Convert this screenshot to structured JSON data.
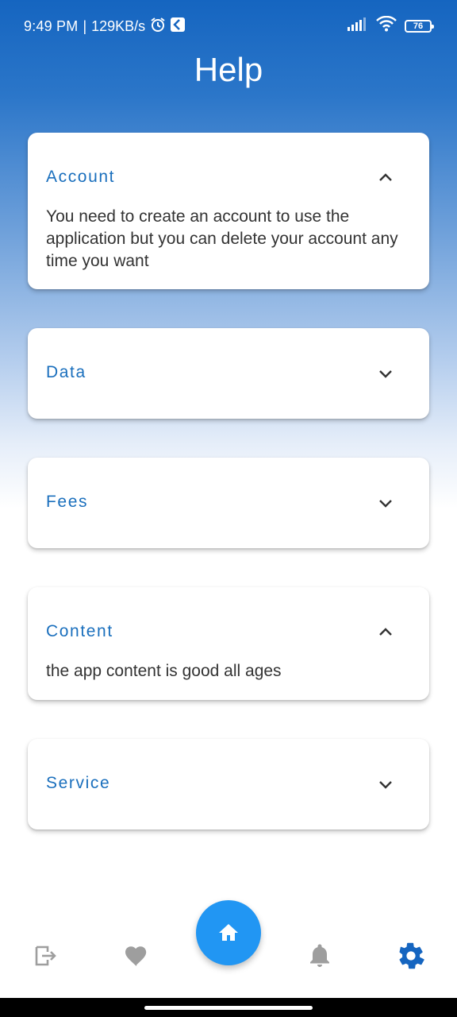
{
  "status": {
    "time": "9:49 PM",
    "separator": "|",
    "speed": "129KB/s",
    "battery": "76"
  },
  "header": {
    "title": "Help"
  },
  "faq": [
    {
      "title": "Account",
      "expanded": true,
      "body": "You need to create an account to use the application but you can delete your account any time you want"
    },
    {
      "title": "Data",
      "expanded": false
    },
    {
      "title": "Fees",
      "expanded": false
    },
    {
      "title": "Content",
      "expanded": true,
      "body": "the app content is good all ages"
    },
    {
      "title": "Service",
      "expanded": false
    }
  ],
  "nav": {
    "items": [
      {
        "icon": "logout-icon",
        "active": false
      },
      {
        "icon": "heart-icon",
        "active": false
      },
      {
        "icon": "home-icon",
        "active": true,
        "fab": true
      },
      {
        "icon": "bell-icon",
        "active": false
      },
      {
        "icon": "gear-icon",
        "active": true
      }
    ]
  },
  "colors": {
    "accent": "#1a6fbd",
    "fab": "#2196f3",
    "inactive_icon": "#9e9e9e",
    "active_icon": "#1565c0"
  }
}
